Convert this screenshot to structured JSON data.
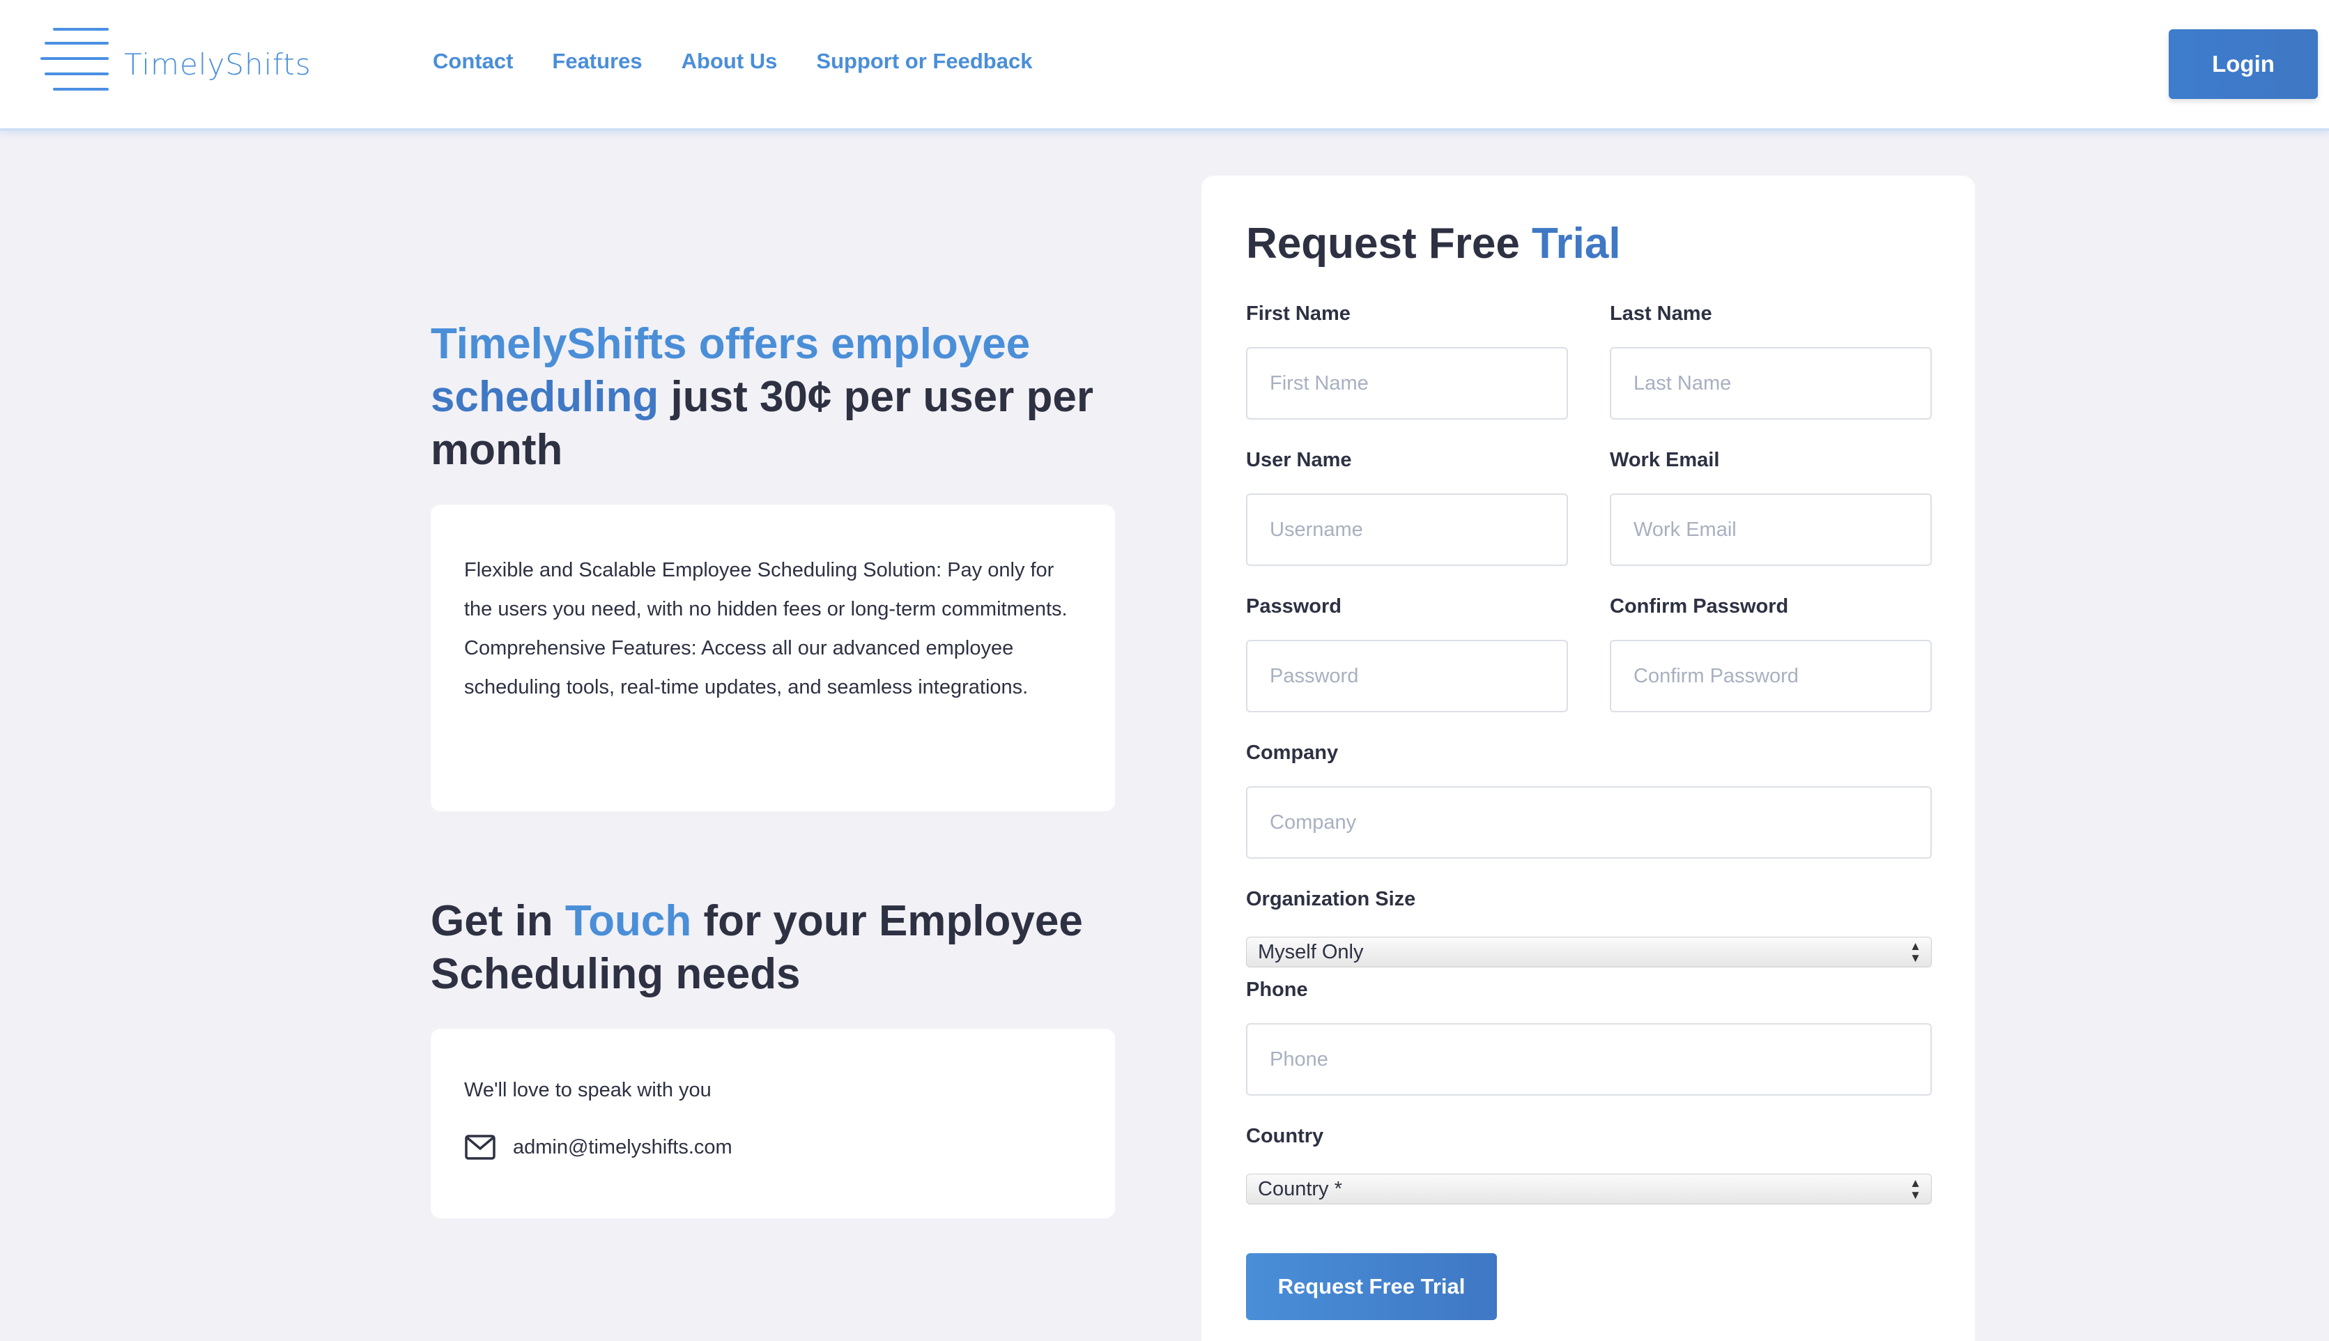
{
  "header": {
    "brand": "TimelyShifts",
    "nav": [
      "Contact",
      "Features",
      "About Us",
      "Support or Feedback"
    ],
    "login_label": "Login"
  },
  "hero": {
    "title_part1": "TimelyShifts offers employee",
    "title_part2": "scheduling",
    "title_part3": " just 30¢ per user per month",
    "description": "Flexible and Scalable Employee Scheduling Solution: Pay only for the users you need, with no hidden fees or long-term commitments. Comprehensive Features: Access all our advanced employee scheduling tools, real-time updates, and seamless integrations."
  },
  "touch": {
    "title_part1": "Get in ",
    "title_part2": "Touch",
    "title_part3": " for your Employee Scheduling needs",
    "speak": "We'll love to speak with you",
    "email": "admin@timelyshifts.com",
    "email_icon": "mail-icon"
  },
  "form": {
    "title_part1": "Request Free ",
    "title_part2": "Trial",
    "first_name_label": "First Name",
    "first_name_placeholder": "First Name",
    "last_name_label": "Last Name",
    "last_name_placeholder": "Last Name",
    "username_label": "User Name",
    "username_placeholder": "Username",
    "email_label": "Work Email",
    "email_placeholder": "Work Email",
    "password_label": "Password",
    "password_placeholder": "Password",
    "confirm_label": "Confirm Password",
    "confirm_placeholder": "Confirm Password",
    "company_label": "Company",
    "company_placeholder": "Company",
    "org_size_label": "Organization Size",
    "org_size_value": "Myself Only",
    "phone_label": "Phone",
    "phone_placeholder": "Phone",
    "country_label": "Country",
    "country_value": "Country *",
    "submit_label": "Request Free Trial"
  },
  "colors": {
    "accent": "#4a8ed8",
    "accent_dark": "#3f78c4",
    "text": "#2d3142",
    "background": "#f2f1f6"
  }
}
